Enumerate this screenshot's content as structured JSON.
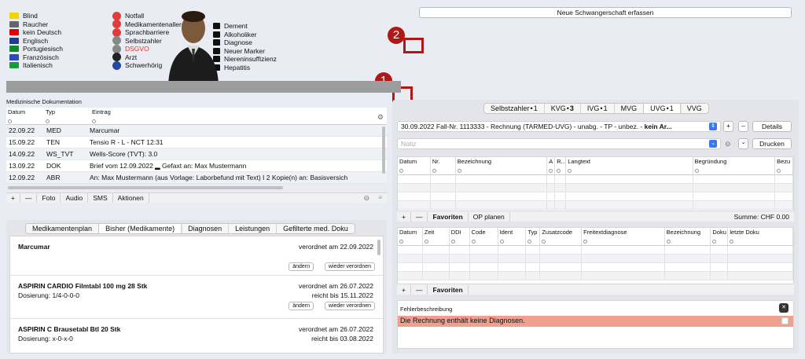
{
  "flags_left": [
    {
      "label": "Blind",
      "icon": "blind-icon",
      "color": "#f3d400"
    },
    {
      "label": "Raucher",
      "icon": "cigarette-icon",
      "color": "#666"
    },
    {
      "label": "kein Deutsch",
      "icon": "german-flag-icon",
      "color": "#d00"
    },
    {
      "label": "Englisch",
      "icon": "uk-flag-icon",
      "color": "#203a8c"
    },
    {
      "label": "Portugiesisch",
      "icon": "portugal-flag-icon",
      "color": "#0a8a2a"
    },
    {
      "label": "Französisch",
      "icon": "france-flag-icon",
      "color": "#2a4bc0"
    },
    {
      "label": "Italienisch",
      "icon": "italy-flag-icon",
      "color": "#1a9a3a"
    }
  ],
  "flags_mid": [
    {
      "label": "Notfall",
      "icon": "emergency-icon",
      "color": "#e23b3b"
    },
    {
      "label": "Medikamentenallergien",
      "icon": "allergy-icon",
      "color": "#e23b3b"
    },
    {
      "label": "Sprachbarriere",
      "icon": "speech-icon",
      "color": "#e23b3b"
    },
    {
      "label": "Selbstzahler",
      "icon": "invoice-icon",
      "color": "#888"
    },
    {
      "label": "DSGVO",
      "icon": "dsgvo-icon",
      "color": "#888",
      "red": true
    },
    {
      "label": "Arzt",
      "icon": "doctor-icon",
      "color": "#222"
    },
    {
      "label": "Schwerhörig",
      "icon": "hearing-icon",
      "color": "#244a9c"
    }
  ],
  "flags_right": [
    "Dement",
    "Alkoholiker",
    "Diagnose",
    "Neuer Marker",
    "Niereninsuffizienz",
    "Hepatitis"
  ],
  "new_pregnancy": "Neue Schwangerschaft erfassen",
  "badge1": "1",
  "badge2": "2",
  "doc": {
    "title": "Medizinische Dokumentation",
    "headers": [
      "Datum",
      "Typ",
      "Eintrag"
    ],
    "rows": [
      {
        "date": "22.09.22",
        "type": "MED",
        "entry": "Marcumar"
      },
      {
        "date": "15.09.22",
        "type": "TEN",
        "entry": "Tensio  R -  L -  NCT  12:31"
      },
      {
        "date": "14.09.22",
        "type": "WS_TVT",
        "entry": "Wells-Score (TVT): 3.0"
      },
      {
        "date": "13.09.22",
        "type": "DOK",
        "entry": "Brief vom 12.09.2022 ▂ Gefaxt an: Max Mustermann"
      },
      {
        "date": "12.09.22",
        "type": "ABR",
        "entry": "An:  Max Mustermann (aus Vorlage: Laborbefund mit Text) I 2 Kopie(n) an: Basisversich"
      }
    ],
    "toolbar": [
      "+",
      "—",
      "Foto",
      "Audio",
      "SMS",
      "Aktionen"
    ]
  },
  "medtabs": [
    "Medikamentenplan",
    "Bisher (Medikamente)",
    "Diagnosen",
    "Leistungen",
    "Gefilterte med. Doku"
  ],
  "medtab_active": 1,
  "meds": [
    {
      "name": "Marcumar",
      "dose": "",
      "ord": "verordnet am 22.09.2022",
      "until": ""
    },
    {
      "name": "ASPIRIN CARDIO Filmtabl 100 mg 28 Stk",
      "dose": "Dosierung: 1/4-0-0-0",
      "ord": "verordnet am 26.07.2022",
      "until": "reicht bis 15.11.2022"
    },
    {
      "name": "ASPIRIN C Brausetabl Btl 20 Stk",
      "dose": "Dosierung: x-0-x-0",
      "ord": "verordnet am 26.07.2022",
      "until": "reicht bis 03.08.2022"
    }
  ],
  "med_buttons": {
    "change": "ändern",
    "reorder": "wieder verordnen"
  },
  "billtabs": [
    {
      "label": "Selbstzahler",
      "count": "1"
    },
    {
      "label": "KVG",
      "count": "3"
    },
    {
      "label": "IVG",
      "count": "1"
    },
    {
      "label": "MVG",
      "count": ""
    },
    {
      "label": "UVG",
      "count": "1"
    },
    {
      "label": "VVG",
      "count": ""
    }
  ],
  "billtab_active": 4,
  "case": {
    "text": "30.09.2022 Fall-Nr. 1113333 - Rechnung (TARMED-UVG) - unabg. - TP - unbez. - ",
    "bold": "kein Ar...",
    "details": "Details",
    "print": "Drucken",
    "note_placeholder": "Notiz"
  },
  "grid1": {
    "headers": [
      "Datum",
      "Nr.",
      "Bezeichnung",
      "A",
      "R...",
      "Langtext",
      "Begründung",
      "Bezu"
    ],
    "toolbar": [
      "+",
      "—",
      "Favoriten",
      "OP planen"
    ],
    "sum": "Summe: CHF 0.00"
  },
  "grid2": {
    "headers": [
      "Datum",
      "Zeit",
      "DDI",
      "Code",
      "Ident",
      "Typ",
      "Zusatzcode",
      "Freitextdiagnose",
      "Bezeichnung",
      "Doku",
      "letzte Doku"
    ],
    "toolbar": [
      "+",
      "—",
      "Favoriten"
    ]
  },
  "errors": {
    "title": "Fehlerbeschreibung",
    "message": "Die Rechnung enthält keine Diagnosen."
  }
}
